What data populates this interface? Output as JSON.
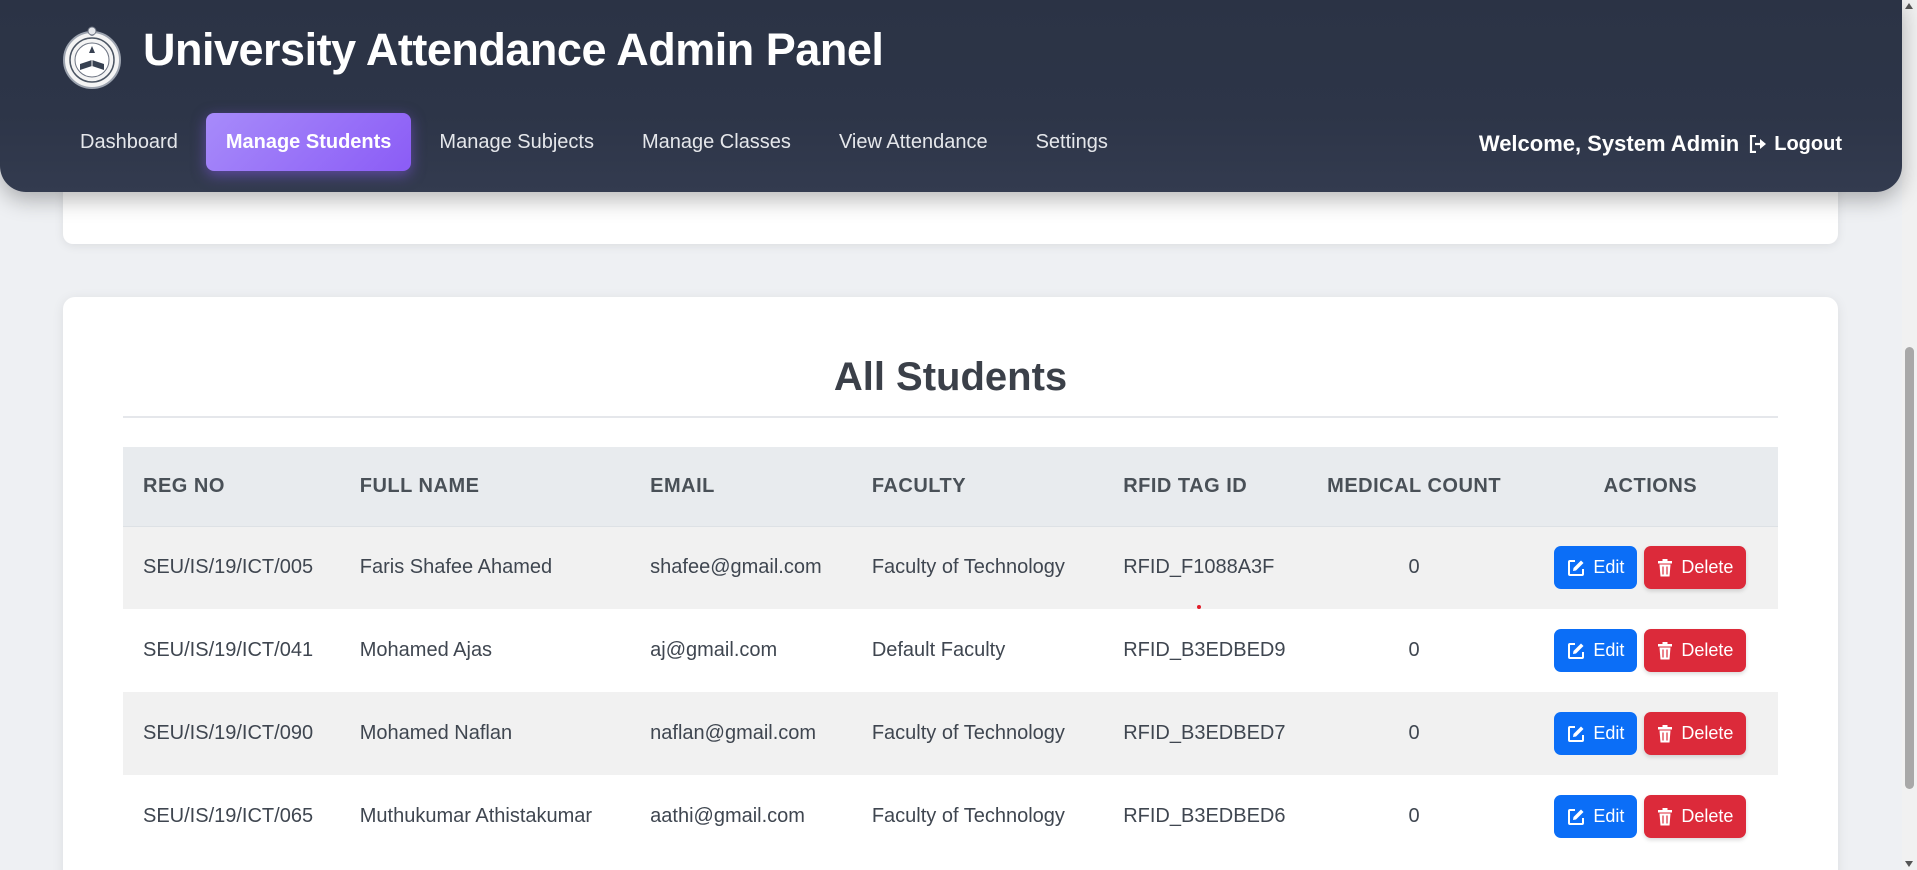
{
  "header": {
    "title": "University Attendance Admin Panel",
    "logo_icon": "university-seal-icon",
    "welcome": "Welcome, System Admin",
    "logout_label": "Logout",
    "nav": [
      {
        "label": "Dashboard",
        "active": false
      },
      {
        "label": "Manage Students",
        "active": true
      },
      {
        "label": "Manage Subjects",
        "active": false
      },
      {
        "label": "Manage Classes",
        "active": false
      },
      {
        "label": "View Attendance",
        "active": false
      },
      {
        "label": "Settings",
        "active": false
      }
    ]
  },
  "students_section": {
    "title": "All Students",
    "columns": [
      "REG NO",
      "FULL NAME",
      "EMAIL",
      "FACULTY",
      "RFID TAG ID",
      "MEDICAL COUNT",
      "ACTIONS"
    ],
    "edit_label": "Edit",
    "delete_label": "Delete",
    "rows": [
      {
        "reg_no": "SEU/IS/19/ICT/005",
        "full_name": "Faris Shafee Ahamed",
        "email": "shafee@gmail.com",
        "faculty": "Faculty of Technology",
        "rfid": "RFID_F1088A3F",
        "medical_count": "0"
      },
      {
        "reg_no": "SEU/IS/19/ICT/041",
        "full_name": "Mohamed Ajas",
        "email": "aj@gmail.com",
        "faculty": "Default Faculty",
        "rfid": "RFID_B3EDBED9",
        "medical_count": "0"
      },
      {
        "reg_no": "SEU/IS/19/ICT/090",
        "full_name": "Mohamed Naflan",
        "email": "naflan@gmail.com",
        "faculty": "Faculty of Technology",
        "rfid": "RFID_B3EDBED7",
        "medical_count": "0"
      },
      {
        "reg_no": "SEU/IS/19/ICT/065",
        "full_name": "Muthukumar Athistakumar",
        "email": "aathi@gmail.com",
        "faculty": "Faculty of Technology",
        "rfid": "RFID_B3EDBED6",
        "medical_count": "0"
      }
    ]
  },
  "colors": {
    "header_bg": "#2d3548",
    "nav_active": "#8b5cf6",
    "edit_button": "#0b6ef7",
    "delete_button": "#dc2a3a"
  }
}
